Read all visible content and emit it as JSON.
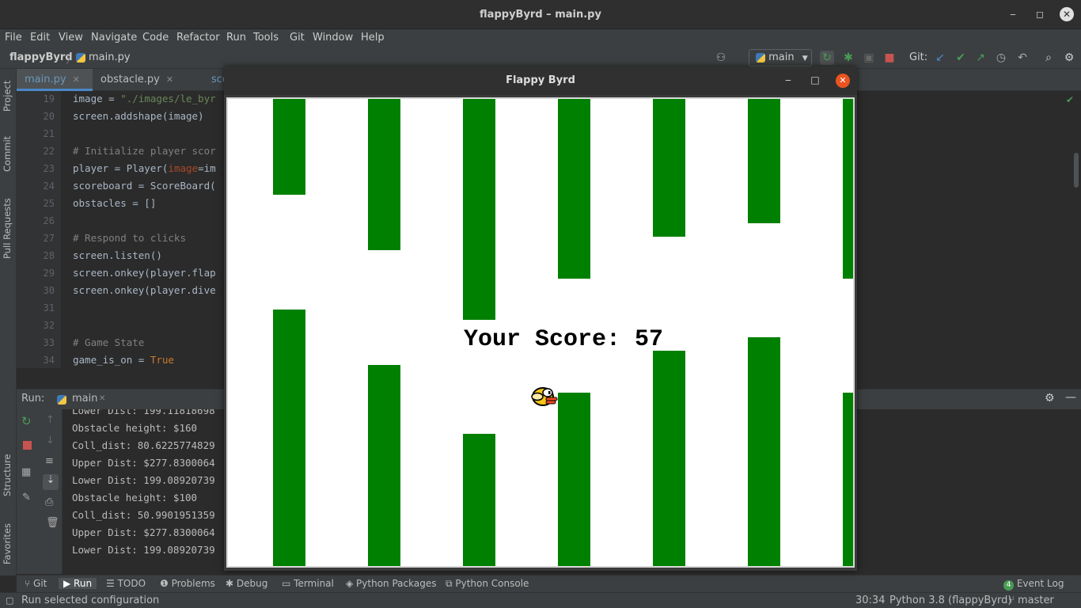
{
  "window": {
    "title": "flappyByrd – main.py",
    "minimize": "‒",
    "maximize": "◻",
    "close": "✕"
  },
  "menu": [
    "File",
    "Edit",
    "View",
    "Navigate",
    "Code",
    "Refactor",
    "Run",
    "Tools",
    "Git",
    "Window",
    "Help"
  ],
  "nav": {
    "project": "flappyByrd",
    "separator": "〉",
    "file": "main.py",
    "branch": "main",
    "git_label": "Git:"
  },
  "side_tabs": [
    "Project",
    "Commit",
    "Pull Requests",
    "Structure",
    "Favorites"
  ],
  "editor_tabs": [
    {
      "label": "main.py",
      "close": "✕"
    },
    {
      "label": "obstacle.py",
      "close": "✕"
    },
    {
      "label": "sco"
    }
  ],
  "code_lines": [
    {
      "num": "19",
      "parts": [
        {
          "t": "image = ",
          "c": ""
        },
        {
          "t": "\"./images/le_byr",
          "c": "str"
        }
      ]
    },
    {
      "num": "20",
      "parts": [
        {
          "t": "screen.addshape(image)",
          "c": ""
        }
      ]
    },
    {
      "num": "21",
      "parts": []
    },
    {
      "num": "22",
      "parts": [
        {
          "t": "# Initialize player scor",
          "c": "cm"
        }
      ]
    },
    {
      "num": "23",
      "parts": [
        {
          "t": "player = Player(",
          "c": ""
        },
        {
          "t": "image",
          "c": "par"
        },
        {
          "t": "=im",
          "c": ""
        }
      ]
    },
    {
      "num": "24",
      "parts": [
        {
          "t": "scoreboard = ScoreBoard(",
          "c": ""
        }
      ]
    },
    {
      "num": "25",
      "parts": [
        {
          "t": "obstacles = []",
          "c": ""
        }
      ]
    },
    {
      "num": "26",
      "parts": []
    },
    {
      "num": "27",
      "parts": [
        {
          "t": "# Respond to clicks",
          "c": "cm"
        }
      ]
    },
    {
      "num": "28",
      "parts": [
        {
          "t": "screen.listen()",
          "c": ""
        }
      ]
    },
    {
      "num": "29",
      "parts": [
        {
          "t": "screen.onkey(player.flap",
          "c": ""
        }
      ]
    },
    {
      "num": "30",
      "parts": [
        {
          "t": "screen.onkey(player.dive",
          "c": ""
        }
      ]
    },
    {
      "num": "31",
      "parts": []
    },
    {
      "num": "32",
      "parts": []
    },
    {
      "num": "33",
      "parts": [
        {
          "t": "# Game State",
          "c": "cm"
        }
      ]
    },
    {
      "num": "34",
      "parts": [
        {
          "t": "game_is_on = ",
          "c": ""
        },
        {
          "t": "True",
          "c": "kw"
        }
      ]
    }
  ],
  "run_panel": {
    "label": "Run:",
    "config": "main",
    "close": "✕",
    "lines": [
      "Lower Dist: 199.11818698",
      "Obstacle height: $160",
      "Coll_dist: 80.6225774829",
      "Upper Dist: $277.8300064",
      "Lower Dist: 199.08920739",
      "Obstacle height: $100",
      "Coll_dist: 50.9901951359",
      "Upper Dist: $277.8300064",
      "Lower Dist: 199.08920739"
    ]
  },
  "bottom_tabs": [
    "Git",
    "Run",
    "TODO",
    "Problems",
    "Debug",
    "Terminal",
    "Python Packages",
    "Python Console"
  ],
  "event_log": {
    "count": "4",
    "label": "Event Log"
  },
  "status": {
    "message": "Run selected configuration",
    "position": "30:34",
    "interpreter": "Python 3.8 (flappyByrd)",
    "branch": "master"
  },
  "game": {
    "title": "Flappy Byrd",
    "minimize": "‒",
    "maximize": "□",
    "close": "✕",
    "score_label": "Your Score: 57",
    "pipe_color": "#008000",
    "pipes": [
      {
        "top_gap_end": 121,
        "bottom_start": 266
      },
      {
        "top_gap_end": 191,
        "bottom_start": 336
      },
      {
        "top_gap_end": 279,
        "bottom_start": 423
      },
      {
        "top_gap_end": 227,
        "bottom_start": 371
      },
      {
        "top_gap_end": 174,
        "bottom_start": 318
      },
      {
        "top_gap_end": 157,
        "bottom_start": 301
      },
      {
        "top_gap_end": 227,
        "bottom_start": 371
      }
    ]
  },
  "colors": {
    "ide_bg": "#2b2b2b",
    "panel_bg": "#3c3f41",
    "accent": "#4a88c7",
    "run_green": "#499c54",
    "stop_red": "#c75450",
    "ubuntu_close": "#e95420"
  }
}
